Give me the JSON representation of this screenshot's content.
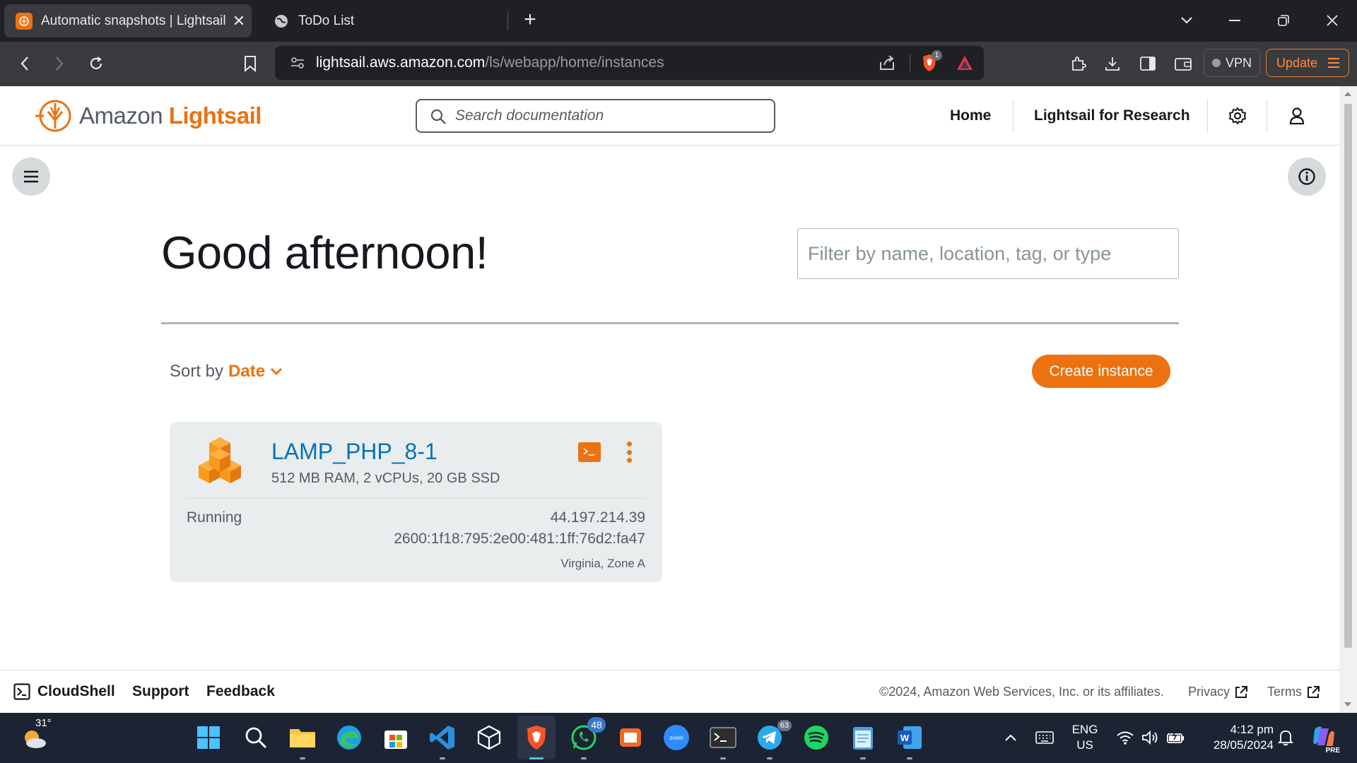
{
  "browser": {
    "tabs": [
      {
        "title": "Automatic snapshots | Lightsail |",
        "active": true
      },
      {
        "title": "ToDo List",
        "active": false
      }
    ],
    "url_host": "lightsail.aws.amazon.com",
    "url_path": "/ls/webapp/home/instances",
    "brave_badge": "1",
    "vpn_label": "VPN",
    "update_label": "Update"
  },
  "lightsail": {
    "brand_prefix": "Amazon",
    "brand_name": "Lightsail",
    "search_placeholder": "Search documentation",
    "nav": {
      "home": "Home",
      "research": "Lightsail for Research"
    },
    "greeting": "Good afternoon!",
    "filter_placeholder": "Filter by name, location, tag, or type",
    "sort_label": "Sort by",
    "sort_value": "Date",
    "create_button": "Create instance",
    "instance": {
      "name": "LAMP_PHP_8-1",
      "spec": "512 MB RAM, 2 vCPUs, 20 GB SSD",
      "state": "Running",
      "ipv4": "44.197.214.39",
      "ipv6": "2600:1f18:795:2e00:481:1ff:76d2:fa47",
      "zone": "Virginia, Zone A"
    },
    "footer": {
      "cloudshell": "CloudShell",
      "support": "Support",
      "feedback": "Feedback",
      "copyright": "©2024, Amazon Web Services, Inc. or its affiliates.",
      "privacy": "Privacy",
      "terms": "Terms"
    }
  },
  "taskbar": {
    "weather_temp": "31°",
    "whatsapp_badge": "48",
    "telegram_badge": "63",
    "language_top": "ENG",
    "language_bottom": "US",
    "time": "4:12 pm",
    "date": "28/05/2024",
    "copilot_badge": "PRE"
  },
  "colors": {
    "accent": "#ec7211",
    "link": "#0073bb",
    "text": "#16191f",
    "taskbar": "#1c2333"
  }
}
